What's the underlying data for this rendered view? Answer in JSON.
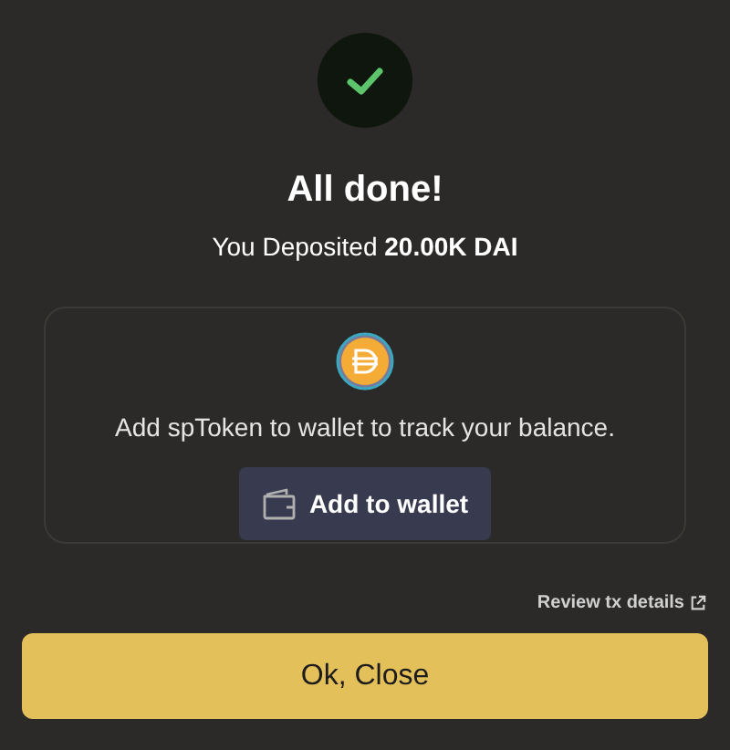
{
  "title": "All done!",
  "subtitle": "You Deposited **20.00K DAI**",
  "card": {
    "message": "Add spToken to wallet to track your balance.",
    "button": "Add to wallet"
  },
  "review_link": "Review tx details",
  "close_button": "Ok, Close"
}
